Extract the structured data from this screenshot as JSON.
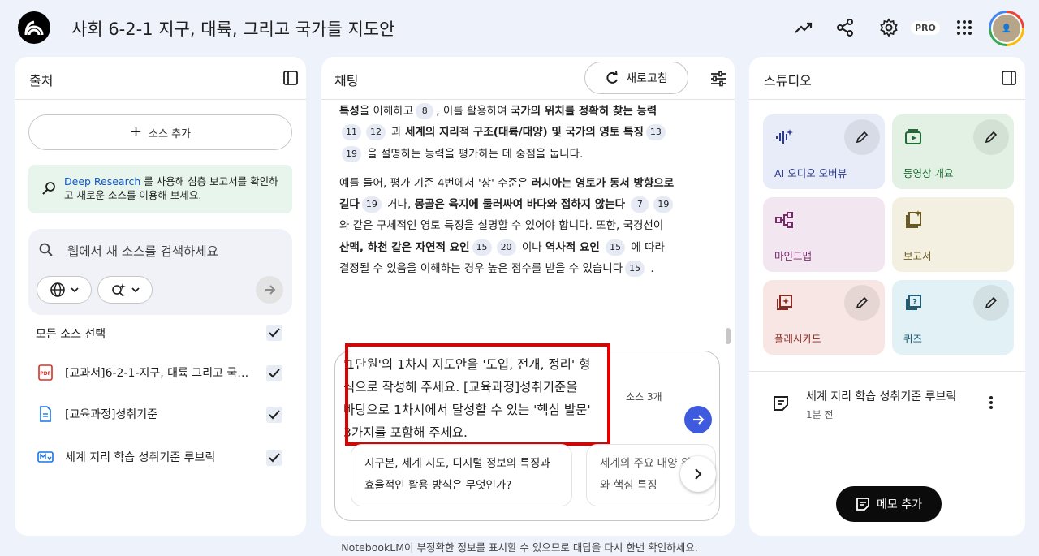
{
  "header": {
    "title": "사회 6-2-1 지구, 대륙, 그리고 국가들 지도안",
    "pro_badge": "PRO",
    "avatar_text": "👤"
  },
  "sources": {
    "title": "출처",
    "add_source": "소스 추가",
    "deep_research_link": "Deep Research",
    "deep_research_text": " 를 사용해 심층 보고서를 확인하고 새로운 소스를 이용해 보세요.",
    "search_placeholder": "웹에서 새 소스를 검색하세요",
    "select_all": "모든 소스 선택",
    "items": [
      {
        "label": "[교과서]6-2-1-지구, 대륙 그리고 국가들",
        "type": "pdf",
        "checked": true
      },
      {
        "label": "[교육과정]성취기준",
        "type": "doc",
        "checked": true
      },
      {
        "label": "세계 지리 학습 성취기준 루브릭",
        "type": "md",
        "checked": true
      }
    ]
  },
  "chat": {
    "title": "채팅",
    "refresh": "새로고침",
    "p1": {
      "t0": "특성",
      "t1": "을 이해하고",
      "c1": "8",
      "t2": ", 이를 활용하여 ",
      "b1": "국가의 위치를 정확히 찾는 능력",
      "c2": "11",
      "c3": "12",
      "t3": " 과 ",
      "b2": "세계의 지리적 구조(대륙/대양) 및 국가의 영토 특징",
      "c4": "13",
      "c5": "19",
      "t4": " 을 설명하는 능력을 평가하는 데 중점을 둡니다."
    },
    "p2": {
      "t0": "예를 들어, 평가 기준 4번에서 '상' 수준은 ",
      "b1": "러시아는 영토가 동서 방향으로 길다",
      "c1": "19",
      "t1": " 거나, ",
      "b2": "몽골은 육지에 둘러싸여 바다와 접하지 않는다",
      "c2": "7",
      "c3": "19",
      "t2": " 와 같은 구체적인 영토 특징을 설명할 수 있어야 합니다. 또한, 국경선이 ",
      "b3": "산맥, 하천 같은 자연적 요인",
      "c4": "15",
      "c5": "20",
      "t3": " 이나 ",
      "b4": "역사적 요인",
      "c6": "15",
      "t4": " 에 따라 결정될 수 있음을 이해하는 경우 높은 점수를 받을 수 있습니다",
      "c7": "15",
      "t5": " ."
    },
    "query": "'1단원'의 1차시 지도안을 '도입, 전개, 정리' 형식으로 작성해 주세요. [교육과정]성취기준을 바탕으로 1차시에서 달성할 수 있는 '핵심 발문' 3가지를 포함해 주세요.",
    "source_count": "소스 3개",
    "suggestions": [
      "지구본, 세계 지도, 디지털 정보의 특징과 효율적인 활용 방식은 무엇인가?",
      "세계의 주요 대양 위치와 핵심 특징"
    ],
    "footer": "NotebookLM이 부정확한 정보를 표시할 수 있으므로 대답을 다시 한번 확인하세요."
  },
  "studio": {
    "title": "스튜디오",
    "tiles": [
      {
        "label": "AI 오디오 오버뷰",
        "bg": "#e7ecf8",
        "fg": "#2b3a8f"
      },
      {
        "label": "동영상 개요",
        "bg": "#e3f1e5",
        "fg": "#1e6b34"
      },
      {
        "label": "마인드맵",
        "bg": "#f2e6f0",
        "fg": "#7a2a6b"
      },
      {
        "label": "보고서",
        "bg": "#f3f0e2",
        "fg": "#6b5a1e"
      },
      {
        "label": "플래시카드",
        "bg": "#f7e6e4",
        "fg": "#8a2a22"
      },
      {
        "label": "퀴즈",
        "bg": "#e2f1f6",
        "fg": "#1d5d78"
      }
    ],
    "note": {
      "title": "세계 지리 학습 성취기준 루브릭",
      "time": "1분 전"
    },
    "add_memo": "메모 추가"
  },
  "colors": {
    "accent_blue": "#3e5be0",
    "highlight_red": "#e00000"
  }
}
